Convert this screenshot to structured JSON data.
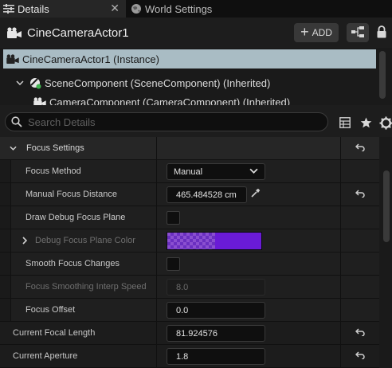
{
  "tabs": [
    {
      "label": "Details",
      "icon": "details-icon",
      "active": true
    },
    {
      "label": "World Settings",
      "icon": "globe-icon",
      "active": false
    }
  ],
  "tab_close": "✕",
  "actor": {
    "name": "CineCameraActor1",
    "icon": "camera-icon"
  },
  "toolbar": {
    "add_label": "ADD",
    "add_plus": "+"
  },
  "tree": {
    "items": [
      {
        "label": "CineCameraActor1 (Instance)",
        "selected": true
      },
      {
        "label": "SceneComponent (SceneComponent) (Inherited)",
        "selected": false
      },
      {
        "label": "CameraComponent (CameraComponent) (Inherited)",
        "selected": false
      }
    ]
  },
  "search": {
    "placeholder": "Search Details",
    "value": ""
  },
  "section": {
    "label": "Focus Settings"
  },
  "properties": {
    "focus_method": {
      "label": "Focus Method",
      "value": "Manual"
    },
    "manual_focus_distance": {
      "label": "Manual Focus Distance",
      "value": "465.484528 cm"
    },
    "draw_debug_focus_plane": {
      "label": "Draw Debug Focus Plane",
      "checked": false
    },
    "debug_focus_plane_color": {
      "label": "Debug Focus Plane Color",
      "color": "#6a1bd6"
    },
    "smooth_focus_changes": {
      "label": "Smooth Focus Changes",
      "checked": false
    },
    "focus_smoothing_interp_speed": {
      "label": "Focus Smoothing Interp Speed",
      "value": "8.0"
    },
    "focus_offset": {
      "label": "Focus Offset",
      "value": "0.0"
    },
    "current_focal_length": {
      "label": "Current Focal Length",
      "value": "81.924576"
    },
    "current_aperture": {
      "label": "Current Aperture",
      "value": "1.8"
    }
  },
  "colors": {
    "selection": "#a9bcc4",
    "panel": "#1a1a1a",
    "accent_purple": "#6a1bd6"
  }
}
